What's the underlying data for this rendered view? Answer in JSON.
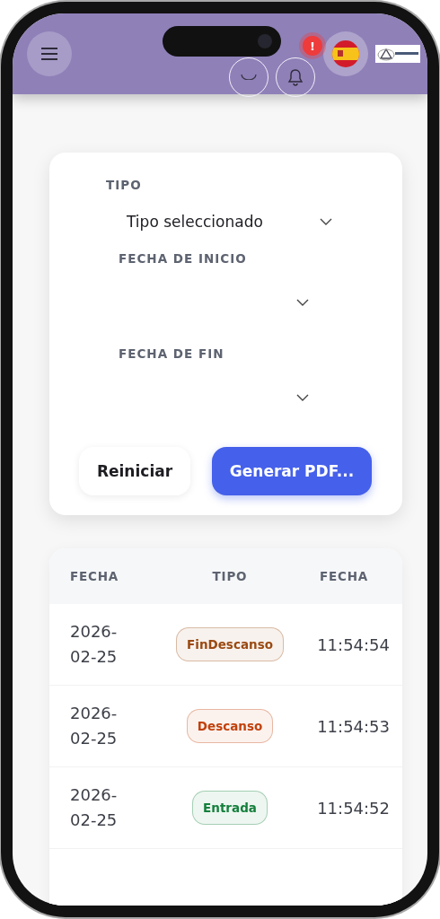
{
  "header": {
    "notification_badge": "!"
  },
  "filters": [
    {
      "label": "TIPO",
      "value": "Tipo seleccionado",
      "kind": "select"
    },
    {
      "label": "FECHA DE INICIO",
      "kind": "date"
    },
    {
      "label": "FECHA DE FIN",
      "kind": "date"
    }
  ],
  "buttons": [
    {
      "label": "Reiniciar",
      "kind": "secondary"
    },
    {
      "label": "Generar PDF...",
      "kind": "primary"
    }
  ],
  "table": {
    "columns": [
      "FECHA",
      "TIPO",
      "FECHA"
    ],
    "rows": [
      {
        "date": "2026-02-25",
        "type": "FinDescanso",
        "color": "#9a4a12",
        "time": "11:54:54"
      },
      {
        "date": "2026-02-25",
        "type": "Descanso",
        "color": "#c2410c",
        "time": "11:54:53"
      },
      {
        "date": "2026-02-25",
        "type": "Entrada",
        "color": "#15803d",
        "time": "11:54:52"
      }
    ]
  }
}
